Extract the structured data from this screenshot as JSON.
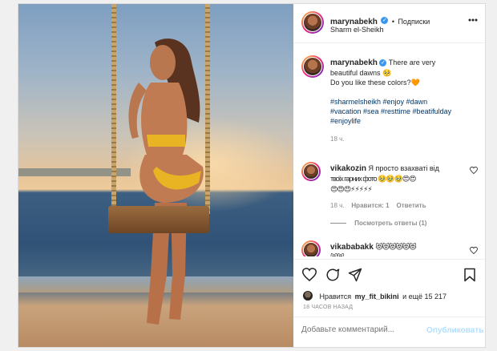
{
  "post": {
    "username": "marynabekh",
    "follow_label": "Подписки",
    "location": "Sharm el-Sheikh"
  },
  "caption": {
    "username": "marynabekh",
    "line1": "There are very",
    "line2": "beautiful dawns 🥺",
    "line3": "Do you like these colors?🧡",
    "hashtags1": "#sharmelsheikh #enjoy #dawn",
    "hashtags2": "#vacation #sea #resttime #beatifulday",
    "hashtags3": "#enjoylife",
    "time": "18 ч."
  },
  "comments": [
    {
      "username": "vikakozin",
      "text1": "Я просто взахваті від",
      "text2": "твоїх гарних фото 🥹🥹🥹😍😍",
      "text3": "😍😍😍⚡⚡⚡⚡⚡",
      "time": "18 ч.",
      "likes": "Нравится: 1",
      "reply": "Ответить",
      "view_replies": "Посмотреть ответы (1)"
    },
    {
      "username": "vikababakk",
      "text1": "😻😻😻😻😻😻",
      "text2": "😻😻"
    }
  ],
  "likes": {
    "prefix": "Нравится",
    "user": "my_fit_bikini",
    "suffix": "и ещё 15 217"
  },
  "timestamp": "18 ЧАСОВ НАЗАД",
  "add_comment": {
    "placeholder": "Добавьте комментарий...",
    "publish_label": "Опубликовать"
  },
  "colors": {
    "verified": "#3897f0",
    "link": "#00376b",
    "publish_disabled": "#b2dffc"
  }
}
